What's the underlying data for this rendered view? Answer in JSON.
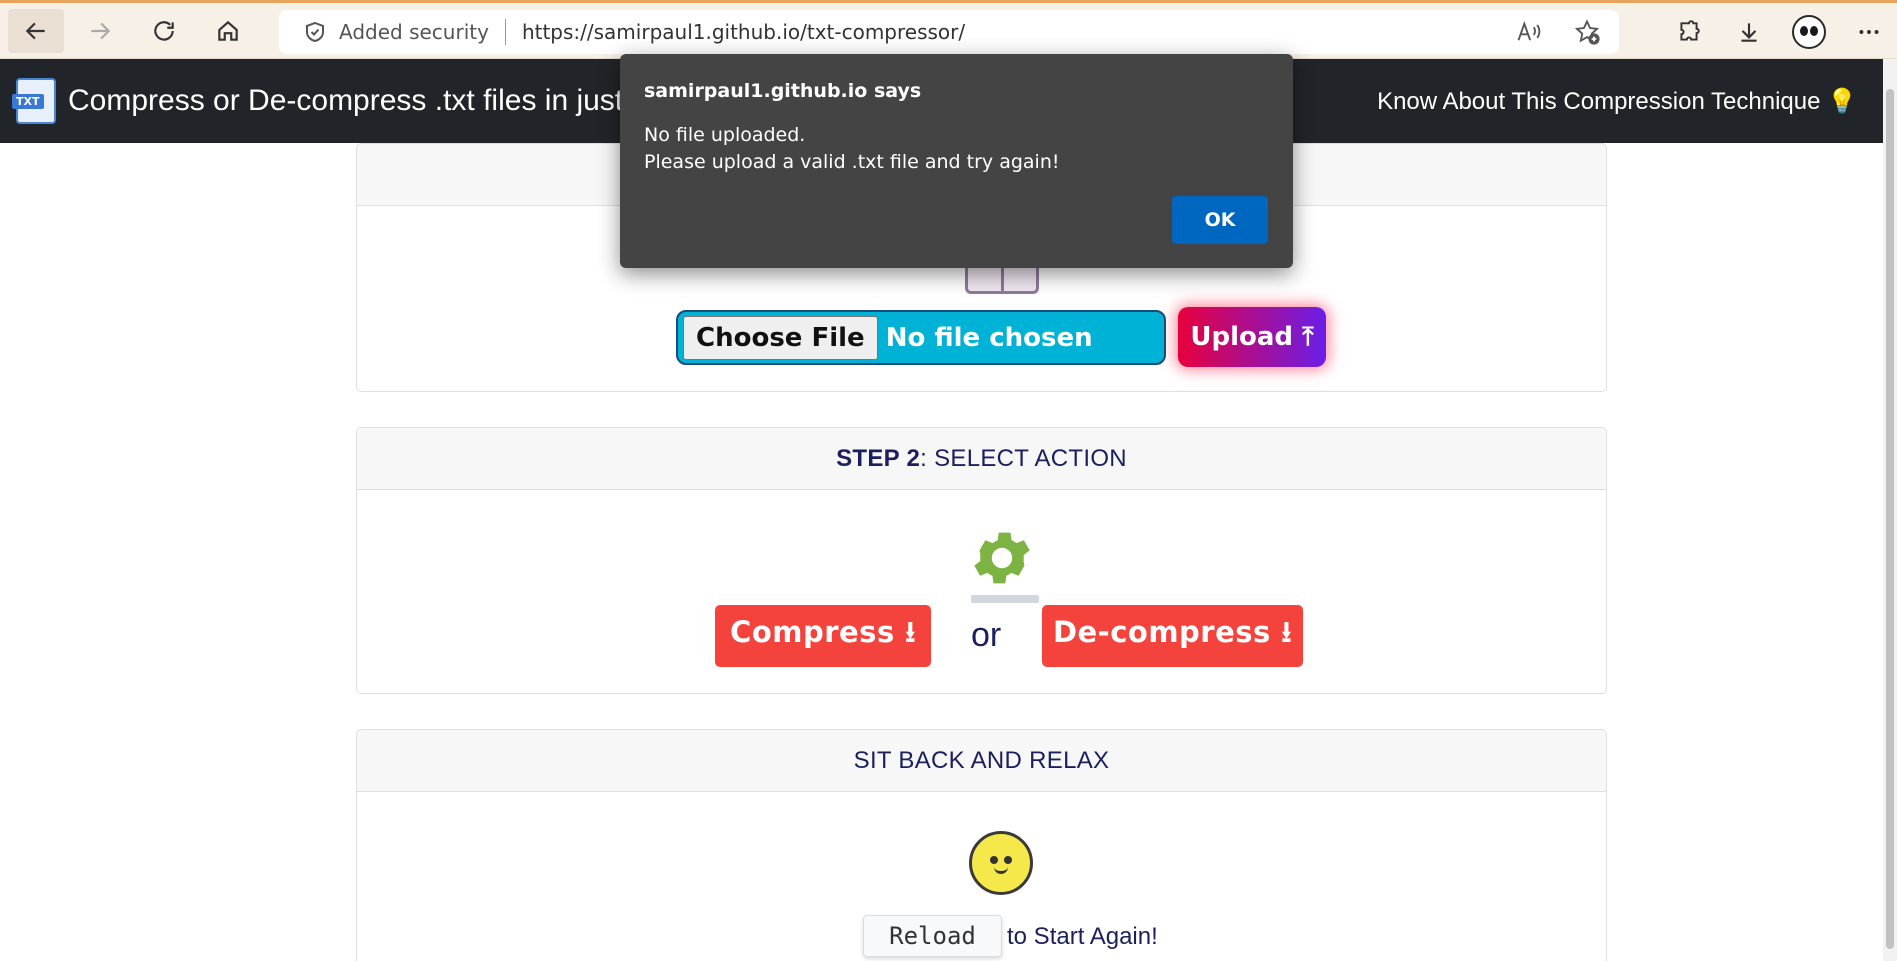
{
  "browser": {
    "security_label": "Added security",
    "url": "https://samirpaul1.github.io/txt-compressor/"
  },
  "navbar": {
    "brand_badge": "TXT",
    "title": "Compress or De-compress .txt files in just",
    "link_label": "Know About This Compression Technique 💡"
  },
  "step1": {
    "choose_label": "Choose File",
    "file_status": "No file chosen",
    "upload_label": "Upload ⤒"
  },
  "step2": {
    "header_bold": "STEP 2",
    "header_rest": ": SELECT ACTION",
    "compress_label": "Compress ⭳",
    "or_label": "or",
    "decompress_label": "De-compress ⭳"
  },
  "step3": {
    "header": "SIT BACK AND RELAX",
    "reload_label": "Reload",
    "again_text": "to Start Again!"
  },
  "dialog": {
    "title": "samirpaul1.github.io says",
    "line1": "No file uploaded.",
    "line2": "Please upload a valid .txt file and try again!",
    "ok_label": "OK"
  },
  "colors": {
    "accent_red": "#f4433c",
    "input_cyan": "#00b3d6",
    "dialog_bg": "#444444",
    "ok_blue": "#0067c0",
    "navbar_bg": "#212529"
  }
}
